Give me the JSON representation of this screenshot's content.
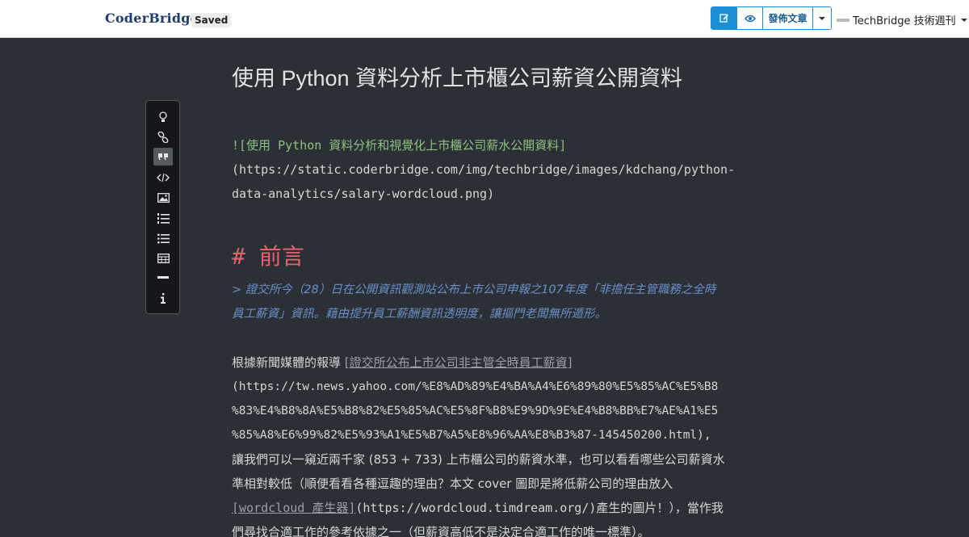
{
  "header": {
    "logo": "CoderBridge",
    "status": "Saved",
    "buttons": {
      "edit_icon": "pencil-icon",
      "preview_icon": "eye-icon",
      "publish_label": "發佈文章",
      "dropdown_icon": "caret-down-icon"
    },
    "user": {
      "name": "TechBridge 技術週刊"
    }
  },
  "toolbar": {
    "items": [
      {
        "icon": "lightbulb-icon"
      },
      {
        "icon": "link-icon"
      },
      {
        "icon": "quote-icon",
        "active": true
      },
      {
        "icon": "code-icon"
      },
      {
        "icon": "image-icon"
      },
      {
        "icon": "ordered-list-icon"
      },
      {
        "icon": "unordered-list-icon"
      },
      {
        "icon": "table-icon"
      },
      {
        "icon": "horizontal-rule-icon"
      },
      {
        "icon": "info-icon"
      }
    ]
  },
  "editor": {
    "title": "使用 Python 資料分析上市櫃公司薪資公開資料",
    "image_markdown": {
      "alt_line": "![使用 Python 資料分析和視覺化上市櫃公司薪水公開資料]",
      "url_line1": "(https://static.coderbridge.com/img/techbridge/images/kdchang/python-",
      "url_line2": "data-analytics/salary-wordcloud.png)"
    },
    "heading": "# 前言",
    "quote": {
      "line1": "> 證交所今（28）日在公開資訊觀測站公布上市公司申報之107年度「非擔任主管職務之全時",
      "line2": "員工薪資」資訊。藉由提升員工薪酬資訊透明度，讓摳門老闆無所遁形。"
    },
    "paragraph": {
      "prefix": "根據新聞媒體的報導 ",
      "link_text": "[證交所公布上市公司非主管全時員工薪資]",
      "url1": "(https://tw.news.yahoo.com/%E8%AD%89%E4%BA%A4%E6%89%80%E5%85%AC%E5%B8",
      "url2": "%83%E4%B8%8A%E5%B8%82%E5%85%AC%E5%8F%B8%E9%9D%9E%E4%B8%BB%E7%AE%A1%E5",
      "url3": "%85%A8%E6%99%82%E5%93%A1%E5%B7%A5%E8%96%AA%E8%B3%87-145450200.html),",
      "line5": "讓我們可以一窺近兩千家 (853 + 733) 上市櫃公司的薪資水準，也可以看看哪些公司薪資水",
      "line6": "準相對較低（順便看看各種逗趣的理由？本文 cover 圖即是將低薪公司的理由放入",
      "line7_link": "[wordcloud 產生器]",
      "line7_rest": "(https://wordcloud.timdream.org/)產生的圖片！），當作我",
      "line8": "們尋找合適工作的參考依據之一（但薪資高低不是決定合適工作的唯一標準）。"
    }
  }
}
